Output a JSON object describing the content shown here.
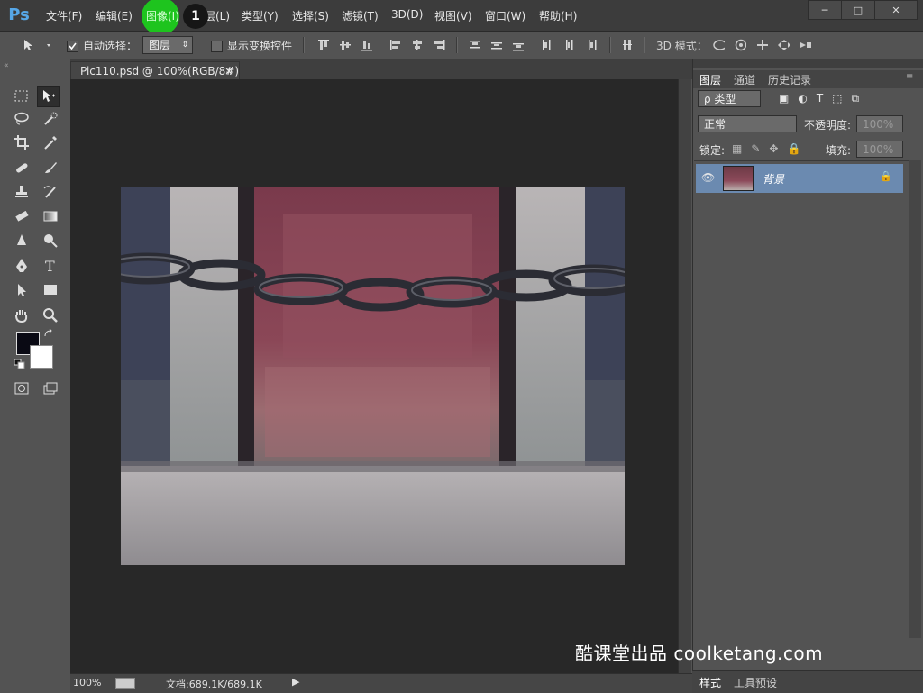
{
  "menubar": {
    "logo": "Ps",
    "items": [
      "文件(F)",
      "编辑(E)",
      "图像(I)",
      "图层(L)",
      "类型(Y)",
      "选择(S)",
      "滤镜(T)",
      "3D(D)",
      "视图(V)",
      "窗口(W)",
      "帮助(H)"
    ],
    "step_badge": "1",
    "win_min": "─",
    "win_max": "□",
    "win_close": "✕"
  },
  "options": {
    "auto_select_label": "自动选择：",
    "auto_select_target": "图层",
    "show_transform_label": "显示变换控件",
    "mode_3d_label": "3D 模式："
  },
  "document": {
    "tab_title": "Pic110.psd @ 100%(RGB/8#)",
    "tab_close": "×",
    "zoom": "100%",
    "doc_size": "文档:689.1K/689.1K"
  },
  "panels": {
    "tabs": [
      "图层",
      "通道",
      "历史记录"
    ],
    "filter_kind": "ρ 类型",
    "blend_mode": "正常",
    "opacity_label": "不透明度:",
    "opacity_value": "100%",
    "lock_label": "锁定:",
    "fill_label": "填充:",
    "fill_value": "100%",
    "layer_name": "背景",
    "bottom_tabs": [
      "样式",
      "工具预设"
    ]
  },
  "watermark": "酷课堂出品 coolketang.com",
  "colors": {
    "foreground": "#0a0a14",
    "background": "#ffffff",
    "layer_highlight": "#6b8ab0",
    "cursor_highlight": "#1ec41e"
  }
}
